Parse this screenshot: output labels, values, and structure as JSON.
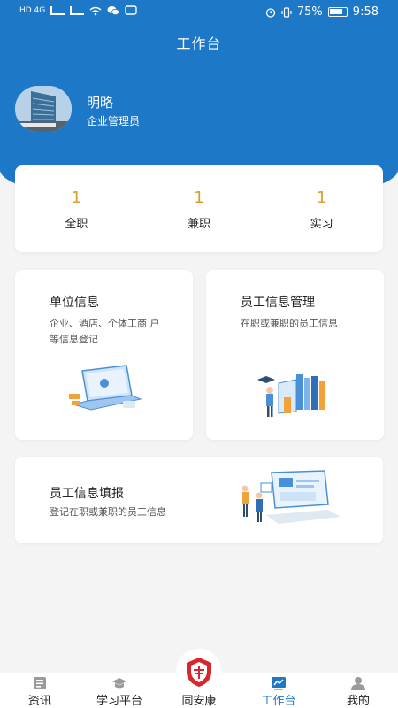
{
  "status_bar": {
    "left_text": "HD 4G",
    "battery": "75%",
    "time": "9:58"
  },
  "header": {
    "title": "工作台"
  },
  "user": {
    "name": "明略",
    "role": "企业管理员"
  },
  "stats": [
    {
      "value": "1",
      "label": "全职"
    },
    {
      "value": "1",
      "label": "兼职"
    },
    {
      "value": "1",
      "label": "实习"
    }
  ],
  "cards": {
    "unit": {
      "title": "单位信息",
      "desc": "企业、酒店、个体工商 户等信息登记"
    },
    "staff": {
      "title": "员工信息管理",
      "desc": "在职或兼职的员工信息"
    },
    "report": {
      "title": "员工信息填报",
      "desc": "登记在职或兼职的员工信息"
    }
  },
  "bottom_nav": [
    {
      "label": "资讯",
      "icon": "news-icon"
    },
    {
      "label": "学习平台",
      "icon": "graduation-cap-icon"
    },
    {
      "label": "同安康",
      "icon": "shield-logo-icon"
    },
    {
      "label": "工作台",
      "icon": "dashboard-icon"
    },
    {
      "label": "我的",
      "icon": "user-icon"
    }
  ],
  "colors": {
    "primary": "#1e78c8",
    "accent_number": "#d4a030",
    "logo_red": "#d8262d"
  }
}
